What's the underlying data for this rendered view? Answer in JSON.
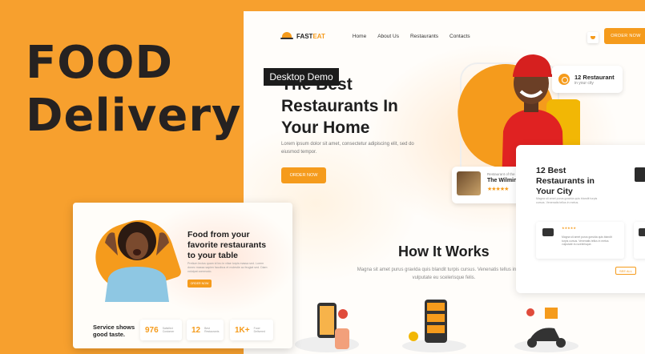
{
  "headline": {
    "line1": "FOOD",
    "line2": "Delivery"
  },
  "site": {
    "brand_a": "FAST",
    "brand_b": "EAT",
    "nav": [
      "Home",
      "About Us",
      "Restaurants",
      "Contacts"
    ],
    "order_button": "ORDER NOW",
    "tooltip": "Desktop Demo",
    "hero": {
      "title_l1": "The Best",
      "title_l2": "Restaurants In",
      "title_l3": "Your Home",
      "subtitle": "Lorem ipsum dolor sit amet, consectetur adipiscing elit, sed do eiusmod tempor.",
      "button": "ORDER NOW"
    },
    "badge": {
      "title": "12 Restaurant",
      "sub": "in your city"
    },
    "restaurant_card": {
      "small": "Restaurant of the",
      "name": "The Wilmington",
      "stars": "★★★★★"
    },
    "how": {
      "title": "How It Works",
      "subtitle": "Magna sit amet purus gravida quis blandit turpis cursus. Venenatis tellus in metus vulputate eu scelerisque felis."
    }
  },
  "side_card": {
    "title_l1": "12 Best",
    "title_l2": "Restaurants in",
    "title_l3": "Your City",
    "subtitle": "Magna sit amet purus gravida quis blandit turpis cursus. Venenatis tellus in metus.",
    "review_stars": "★★★★★",
    "review_text": "Magna sit amet purus gravida quis blandit turpis cursus. Venenatis tellus in metus vulputate eu scelerisque.",
    "see_all": "SEE ALL"
  },
  "left_card": {
    "title_l1": "Food from your",
    "title_l2": "favorite restaurants",
    "title_l3": "to your table",
    "subtitle": "Pretium lectus quam id leo in vitae turpis massa sed. Lorem donec massa sapien faucibus et molestie ac feugiat sed. Diam volutpat commodo.",
    "button": "ORDER NOW",
    "service_l1": "Service shows",
    "service_l2": "good taste.",
    "stats": [
      {
        "num": "976",
        "label": "Satisfied Customer"
      },
      {
        "num": "12",
        "label": "Best Restaurants"
      },
      {
        "num": "1K+",
        "label": "Food Delivered"
      }
    ]
  }
}
